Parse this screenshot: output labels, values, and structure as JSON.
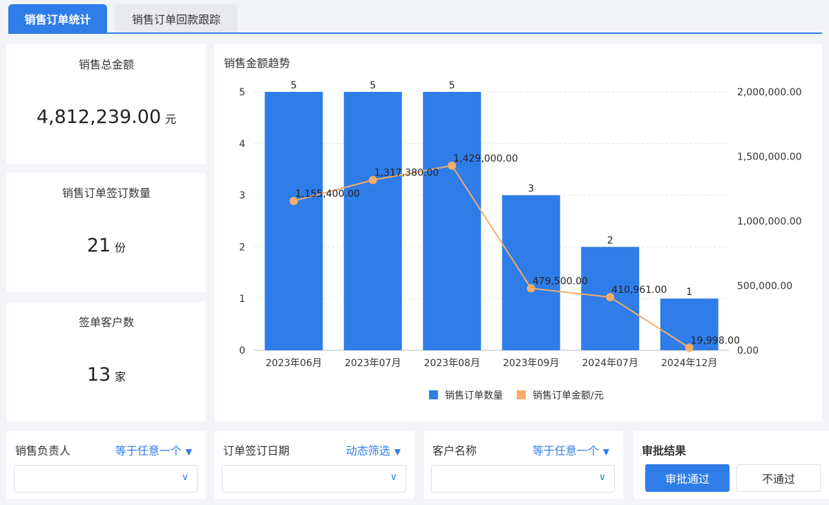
{
  "tabs": [
    {
      "label": "销售订单统计"
    },
    {
      "label": "销售订单回款跟踪"
    }
  ],
  "kpis": [
    {
      "title": "销售总金额",
      "value": "4,812,239.00",
      "unit": "元"
    },
    {
      "title": "销售订单签订数量",
      "value": "21",
      "unit": "份"
    },
    {
      "title": "签单客户数",
      "value": "13",
      "unit": "家"
    }
  ],
  "colors": {
    "bar": "#2f7de8",
    "line": "#f5ac68",
    "accent": "#2f7de8"
  },
  "chart_data": {
    "type": "bar+line",
    "title": "销售金额趋势",
    "categories": [
      "2023年06月",
      "2023年07月",
      "2023年08月",
      "2023年09月",
      "2024年07月",
      "2024年12月"
    ],
    "series": [
      {
        "name": "销售订单数量",
        "type": "bar",
        "axis": "left",
        "values": [
          5,
          5,
          5,
          3,
          2,
          1
        ],
        "labels": [
          "5",
          "5",
          "5",
          "3",
          "2",
          "1"
        ]
      },
      {
        "name": "销售订单金额/元",
        "type": "line",
        "axis": "right",
        "values": [
          1155400,
          1317380,
          1429000,
          479500,
          410961,
          19998
        ],
        "labels": [
          "1,155,400.00",
          "1,317,380.00",
          "1,429,000.00",
          "479,500.00",
          "410,961.00",
          "19,998.00"
        ]
      }
    ],
    "left_axis": {
      "ylim": [
        0,
        5
      ],
      "ticks": [
        "0",
        "1",
        "2",
        "3",
        "4",
        "5"
      ]
    },
    "right_axis": {
      "ylim": [
        0,
        2000000
      ],
      "ticks": [
        "0.00",
        "500,000.00",
        "1,000,000.00",
        "1,500,000.00",
        "2,000,000.00"
      ]
    },
    "legend": "bottom-center",
    "grid": true
  },
  "filters": [
    {
      "label": "销售负责人",
      "mode": "等于任意一个"
    },
    {
      "label": "订单签订日期",
      "mode": "动态筛选"
    },
    {
      "label": "客户名称",
      "mode": "等于任意一个"
    }
  ],
  "approval": {
    "title": "审批结果",
    "approve": "审批通过",
    "reject": "不通过"
  }
}
